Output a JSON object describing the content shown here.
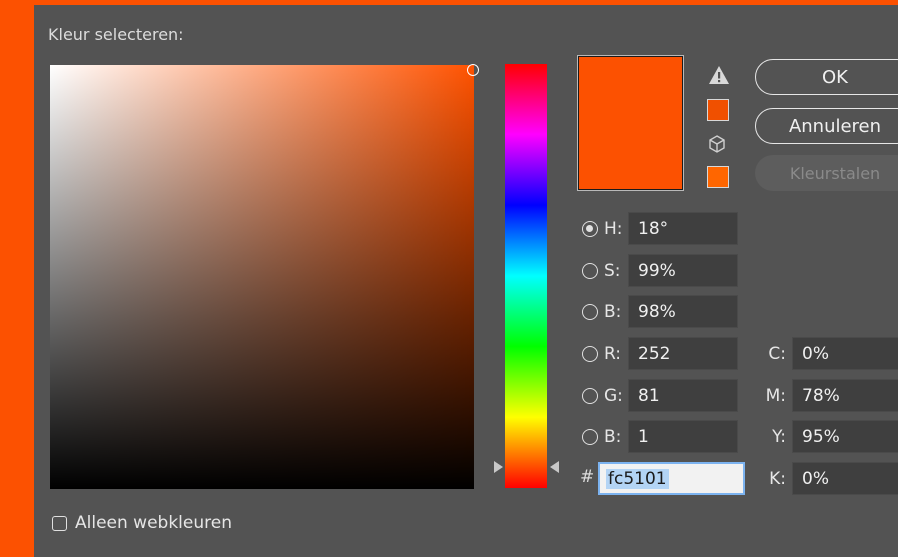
{
  "title": "Kleur selecteren:",
  "colors": {
    "current": "#fc5101",
    "warning_swatch": "#f05000",
    "web_safe_swatch": "#ff6600"
  },
  "buttons": {
    "ok": "OK",
    "cancel": "Annuleren",
    "swatches": "Kleurstalen"
  },
  "hsb": [
    {
      "label": "H:",
      "value": "18°",
      "selected": true
    },
    {
      "label": "S:",
      "value": "99%",
      "selected": false
    },
    {
      "label": "B:",
      "value": "98%",
      "selected": false
    }
  ],
  "rgb": [
    {
      "label": "R:",
      "value": "252",
      "selected": false
    },
    {
      "label": "G:",
      "value": "81",
      "selected": false
    },
    {
      "label": "B:",
      "value": "1",
      "selected": false
    }
  ],
  "cmyk": [
    {
      "label": "C:",
      "value": "0%"
    },
    {
      "label": "M:",
      "value": "78%"
    },
    {
      "label": "Y:",
      "value": "95%"
    },
    {
      "label": "K:",
      "value": "0%"
    }
  ],
  "hex": {
    "prefix": "#",
    "value": "fc5101"
  },
  "web_only": {
    "label": "Alleen webkleuren",
    "checked": false
  },
  "icons": {
    "gamut_warning": "warning-triangle-icon",
    "web_safe": "cube-icon"
  }
}
